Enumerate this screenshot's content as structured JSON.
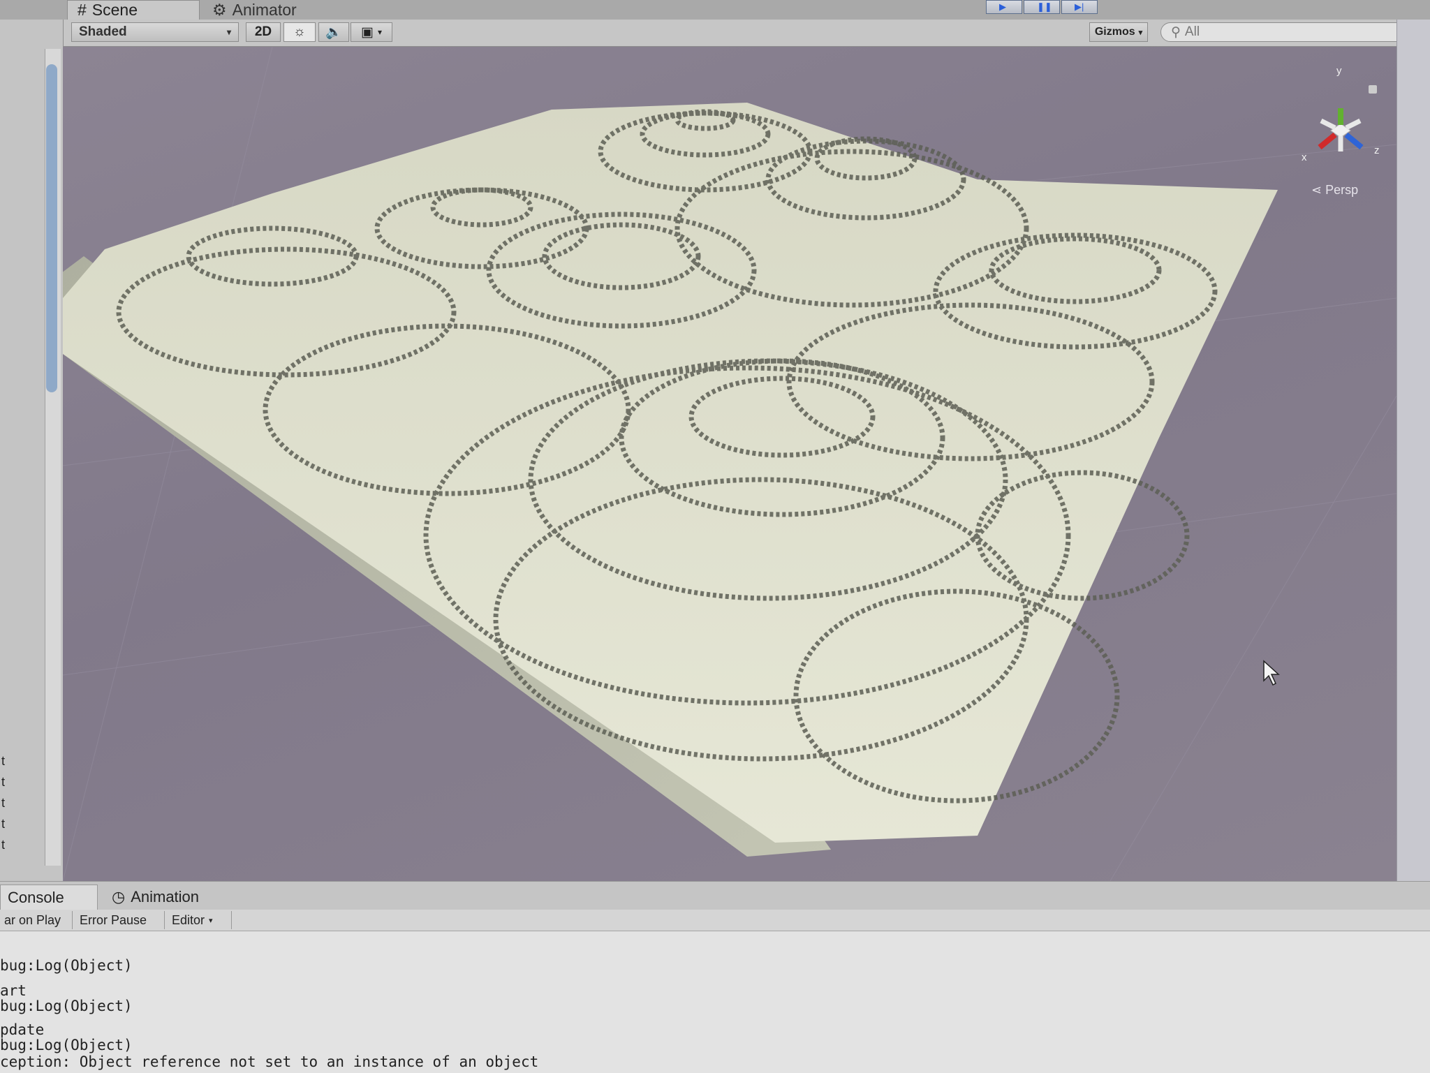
{
  "window_tabs": {
    "scene": "Scene",
    "animator": "Animator"
  },
  "toolbar": {
    "shading_mode": "Shaded",
    "mode_2d": "2D",
    "gizmos": "Gizmos",
    "search_placeholder": "All"
  },
  "scene_view": {
    "projection_label": "Persp",
    "axis_x": "x",
    "axis_y": "y",
    "axis_z": "z",
    "axis_colors": {
      "x": "#d12b2b",
      "y": "#62b12f",
      "z": "#2f64d6"
    }
  },
  "hierarchy": {
    "visible_fragments": [
      "t",
      "t",
      "t",
      "t",
      "t"
    ]
  },
  "bottom_tabs": {
    "console": "Console",
    "animation": "Animation"
  },
  "console_toolbar": {
    "clear_on_play": "ar on Play",
    "error_pause": "Error Pause",
    "editor": "Editor"
  },
  "console_log": [
    "bug:Log(Object)",
    "art",
    "bug:Log(Object)",
    "pdate",
    "bug:Log(Object)",
    "ception: Object reference not set to an instance of an object"
  ]
}
